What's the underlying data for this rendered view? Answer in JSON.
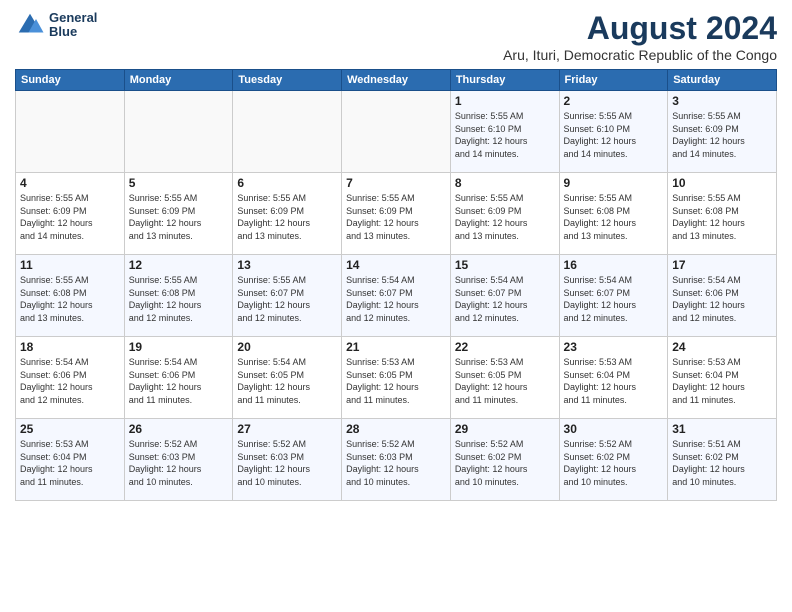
{
  "header": {
    "logo_line1": "General",
    "logo_line2": "Blue",
    "title": "August 2024",
    "subtitle": "Aru, Ituri, Democratic Republic of the Congo"
  },
  "calendar": {
    "weekdays": [
      "Sunday",
      "Monday",
      "Tuesday",
      "Wednesday",
      "Thursday",
      "Friday",
      "Saturday"
    ],
    "weeks": [
      [
        {
          "day": "",
          "info": ""
        },
        {
          "day": "",
          "info": ""
        },
        {
          "day": "",
          "info": ""
        },
        {
          "day": "",
          "info": ""
        },
        {
          "day": "1",
          "info": "Sunrise: 5:55 AM\nSunset: 6:10 PM\nDaylight: 12 hours\nand 14 minutes."
        },
        {
          "day": "2",
          "info": "Sunrise: 5:55 AM\nSunset: 6:10 PM\nDaylight: 12 hours\nand 14 minutes."
        },
        {
          "day": "3",
          "info": "Sunrise: 5:55 AM\nSunset: 6:09 PM\nDaylight: 12 hours\nand 14 minutes."
        }
      ],
      [
        {
          "day": "4",
          "info": "Sunrise: 5:55 AM\nSunset: 6:09 PM\nDaylight: 12 hours\nand 14 minutes."
        },
        {
          "day": "5",
          "info": "Sunrise: 5:55 AM\nSunset: 6:09 PM\nDaylight: 12 hours\nand 13 minutes."
        },
        {
          "day": "6",
          "info": "Sunrise: 5:55 AM\nSunset: 6:09 PM\nDaylight: 12 hours\nand 13 minutes."
        },
        {
          "day": "7",
          "info": "Sunrise: 5:55 AM\nSunset: 6:09 PM\nDaylight: 12 hours\nand 13 minutes."
        },
        {
          "day": "8",
          "info": "Sunrise: 5:55 AM\nSunset: 6:09 PM\nDaylight: 12 hours\nand 13 minutes."
        },
        {
          "day": "9",
          "info": "Sunrise: 5:55 AM\nSunset: 6:08 PM\nDaylight: 12 hours\nand 13 minutes."
        },
        {
          "day": "10",
          "info": "Sunrise: 5:55 AM\nSunset: 6:08 PM\nDaylight: 12 hours\nand 13 minutes."
        }
      ],
      [
        {
          "day": "11",
          "info": "Sunrise: 5:55 AM\nSunset: 6:08 PM\nDaylight: 12 hours\nand 13 minutes."
        },
        {
          "day": "12",
          "info": "Sunrise: 5:55 AM\nSunset: 6:08 PM\nDaylight: 12 hours\nand 12 minutes."
        },
        {
          "day": "13",
          "info": "Sunrise: 5:55 AM\nSunset: 6:07 PM\nDaylight: 12 hours\nand 12 minutes."
        },
        {
          "day": "14",
          "info": "Sunrise: 5:54 AM\nSunset: 6:07 PM\nDaylight: 12 hours\nand 12 minutes."
        },
        {
          "day": "15",
          "info": "Sunrise: 5:54 AM\nSunset: 6:07 PM\nDaylight: 12 hours\nand 12 minutes."
        },
        {
          "day": "16",
          "info": "Sunrise: 5:54 AM\nSunset: 6:07 PM\nDaylight: 12 hours\nand 12 minutes."
        },
        {
          "day": "17",
          "info": "Sunrise: 5:54 AM\nSunset: 6:06 PM\nDaylight: 12 hours\nand 12 minutes."
        }
      ],
      [
        {
          "day": "18",
          "info": "Sunrise: 5:54 AM\nSunset: 6:06 PM\nDaylight: 12 hours\nand 12 minutes."
        },
        {
          "day": "19",
          "info": "Sunrise: 5:54 AM\nSunset: 6:06 PM\nDaylight: 12 hours\nand 11 minutes."
        },
        {
          "day": "20",
          "info": "Sunrise: 5:54 AM\nSunset: 6:05 PM\nDaylight: 12 hours\nand 11 minutes."
        },
        {
          "day": "21",
          "info": "Sunrise: 5:53 AM\nSunset: 6:05 PM\nDaylight: 12 hours\nand 11 minutes."
        },
        {
          "day": "22",
          "info": "Sunrise: 5:53 AM\nSunset: 6:05 PM\nDaylight: 12 hours\nand 11 minutes."
        },
        {
          "day": "23",
          "info": "Sunrise: 5:53 AM\nSunset: 6:04 PM\nDaylight: 12 hours\nand 11 minutes."
        },
        {
          "day": "24",
          "info": "Sunrise: 5:53 AM\nSunset: 6:04 PM\nDaylight: 12 hours\nand 11 minutes."
        }
      ],
      [
        {
          "day": "25",
          "info": "Sunrise: 5:53 AM\nSunset: 6:04 PM\nDaylight: 12 hours\nand 11 minutes."
        },
        {
          "day": "26",
          "info": "Sunrise: 5:52 AM\nSunset: 6:03 PM\nDaylight: 12 hours\nand 10 minutes."
        },
        {
          "day": "27",
          "info": "Sunrise: 5:52 AM\nSunset: 6:03 PM\nDaylight: 12 hours\nand 10 minutes."
        },
        {
          "day": "28",
          "info": "Sunrise: 5:52 AM\nSunset: 6:03 PM\nDaylight: 12 hours\nand 10 minutes."
        },
        {
          "day": "29",
          "info": "Sunrise: 5:52 AM\nSunset: 6:02 PM\nDaylight: 12 hours\nand 10 minutes."
        },
        {
          "day": "30",
          "info": "Sunrise: 5:52 AM\nSunset: 6:02 PM\nDaylight: 12 hours\nand 10 minutes."
        },
        {
          "day": "31",
          "info": "Sunrise: 5:51 AM\nSunset: 6:02 PM\nDaylight: 12 hours\nand 10 minutes."
        }
      ]
    ]
  }
}
